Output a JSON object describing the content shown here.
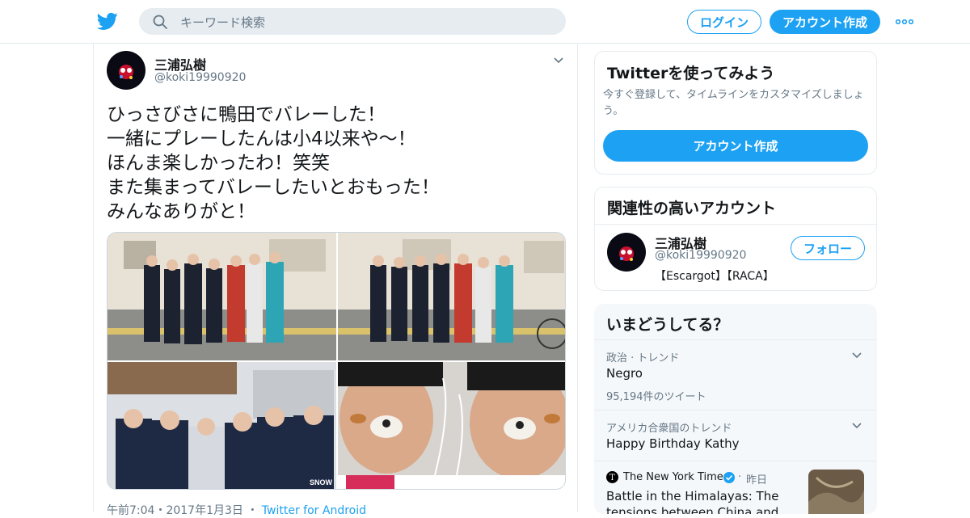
{
  "header": {
    "search_placeholder": "キーワード検索",
    "login_label": "ログイン",
    "signup_label": "アカウント作成"
  },
  "tweet": {
    "author_name": "三浦弘樹",
    "author_handle": "@koki19990920",
    "lines": [
      "ひっさびさに鴨田でバレーした！",
      "一緒にプレーしたんは小4以来や～！",
      "ほんま楽しかったわ！笑笑",
      "また集まってバレーしたいとおもった！",
      "みんなありがと！"
    ],
    "photo_watermark": "SNOW",
    "timestamp": "午前7:04・2017年1月3日",
    "via": "Twitter for Android"
  },
  "signup_card": {
    "title": "Twitterを使ってみよう",
    "desc": "今すぐ登録して、タイムラインをカスタマイズしましょう。",
    "button": "アカウント作成"
  },
  "related": {
    "title": "関連性の高いアカウント",
    "name": "三浦弘樹",
    "handle": "@koki19990920",
    "bio": "【Escargot】【RACA】",
    "follow_label": "フォロー"
  },
  "trends": {
    "title": "いまどうしてる？",
    "items": [
      {
        "context": "政治 · トレンド",
        "name": "Negro",
        "count": "95,194件のツイート"
      },
      {
        "context": "アメリカ合衆国のトレンド",
        "name": "Happy Birthday Kathy"
      }
    ],
    "news": {
      "source": "The New York Times",
      "time": "昨日",
      "headline": "Battle in the Himalayas: The tensions between China and India"
    }
  },
  "colors": {
    "accent": "#1da1f2",
    "text": "#14171a",
    "muted": "#657786"
  }
}
